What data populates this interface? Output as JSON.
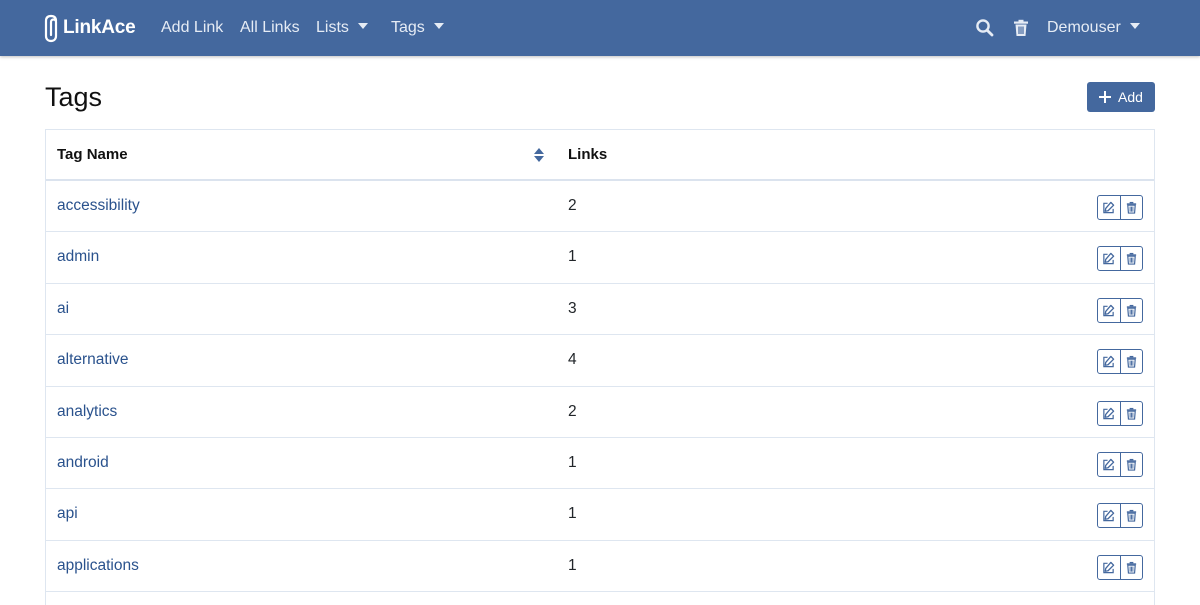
{
  "nav": {
    "brand": "LinkAce",
    "items": [
      {
        "label": "Add Link"
      },
      {
        "label": "All Links"
      },
      {
        "label": "Lists"
      },
      {
        "label": "Tags"
      }
    ],
    "search_icon": "search-icon",
    "trash_icon": "trash-icon",
    "user": "Demouser"
  },
  "page": {
    "title": "Tags",
    "add_label": "Add"
  },
  "table": {
    "headers": {
      "name": "Tag Name",
      "links": "Links"
    },
    "rows": [
      {
        "name": "accessibility",
        "links": "2"
      },
      {
        "name": "admin",
        "links": "1"
      },
      {
        "name": "ai",
        "links": "3"
      },
      {
        "name": "alternative",
        "links": "4"
      },
      {
        "name": "analytics",
        "links": "2"
      },
      {
        "name": "android",
        "links": "1"
      },
      {
        "name": "api",
        "links": "1"
      },
      {
        "name": "applications",
        "links": "1"
      }
    ]
  },
  "colors": {
    "navbar": "#44689e",
    "link": "#2a528d",
    "border": "#dee6f0"
  }
}
